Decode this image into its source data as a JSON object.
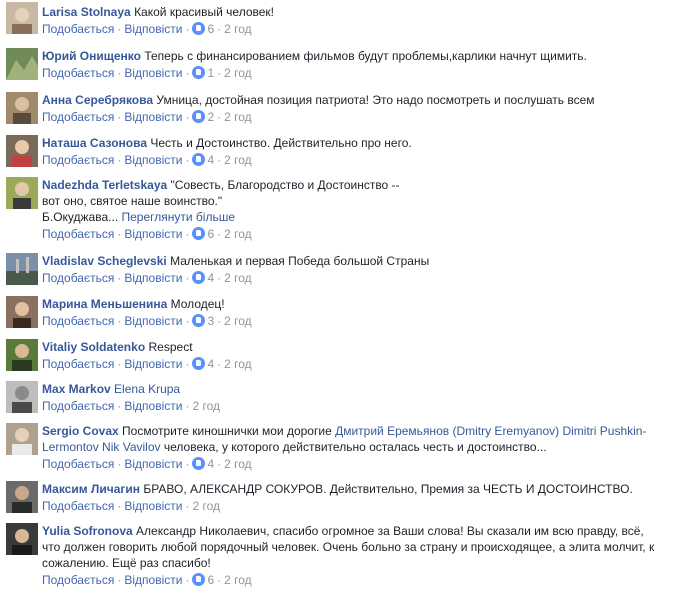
{
  "actions": {
    "like": "Подобається",
    "reply": "Відповісти",
    "sep": "·",
    "time": "2 год"
  },
  "comments": [
    {
      "author": "Larisa Stolnaya",
      "text": "Какой красивый человек!",
      "likes": "6",
      "avatar_color": "#c9b9a4"
    },
    {
      "author": "Юрий Онищенко",
      "text": "Теперь с финансированием фильмов будут проблемы,карлики начнут щимить.",
      "likes": "1",
      "avatar_color": "#6f8b5a"
    },
    {
      "author": "Анна Серебрякова",
      "text": "Умница, достойная позиция патриота! Это надо посмотреть и послушать всем",
      "likes": "2",
      "avatar_color": "#a08a6c"
    },
    {
      "author": "Наташа Сазонова",
      "text": "Честь и Достоинство. Действительно про него.",
      "likes": "4",
      "avatar_color": "#7a6a5a"
    },
    {
      "author": "Nadezhda Terletskaya",
      "text": "\"Совесть, Благородство и Достоинство --",
      "text2": "вот оно, святое наше воинство.\"",
      "text3": "Б.Окуджава...",
      "see_more": "Переглянути більше",
      "likes": "6",
      "avatar_color": "#9aaa58"
    },
    {
      "author": "Vladislav Scheglevski",
      "text": "Маленькая и первая Победа большой Страны",
      "likes": "4",
      "avatar_color": "#7b8fa8"
    },
    {
      "author": "Марина Меньшенина",
      "text": "Молодец!",
      "likes": "3",
      "avatar_color": "#8a7060"
    },
    {
      "author": "Vitaliy Soldatenko",
      "text": "Respect",
      "likes": "4",
      "avatar_color": "#5a7a3a"
    },
    {
      "author": "Max Markov",
      "tag": "Elena Krupa",
      "text": "",
      "avatar_color": "#9a9a9a"
    },
    {
      "author": "Sergio Covax",
      "text": "Посмотрите киношнички мои дорогие",
      "tag1": "Дмитрий Еремьянов (Dmitry Eremyanov)",
      "tag2": "Dimitri Pushkin-",
      "tag3": "Lermontov",
      "tag4": "Nik Vavilov",
      "text_after": "человека, у которого действительно осталась честь и достоинство...",
      "likes": "4",
      "avatar_color": "#b0a090"
    },
    {
      "author": "Максим Личагин",
      "text": "БРАВО, АЛЕКСАНДР СОКУРОВ. Действительно, Премия за ЧЕСТЬ И ДОСТОИНСТВО.",
      "likes": "",
      "avatar_color": "#6a6a6a"
    },
    {
      "author": "Yulia Sofronova",
      "text": "Александр Николаевич, спасибо огромное за Ваши слова! Вы сказали им всю правду, всё,",
      "text2": "что должен говорить любой порядочный человек. Очень больно за страну и происходящее, а элита молчит, к",
      "text3": "сожалению. Ещё раз спасибо!",
      "likes": "6",
      "avatar_color": "#3a3a3a"
    }
  ]
}
